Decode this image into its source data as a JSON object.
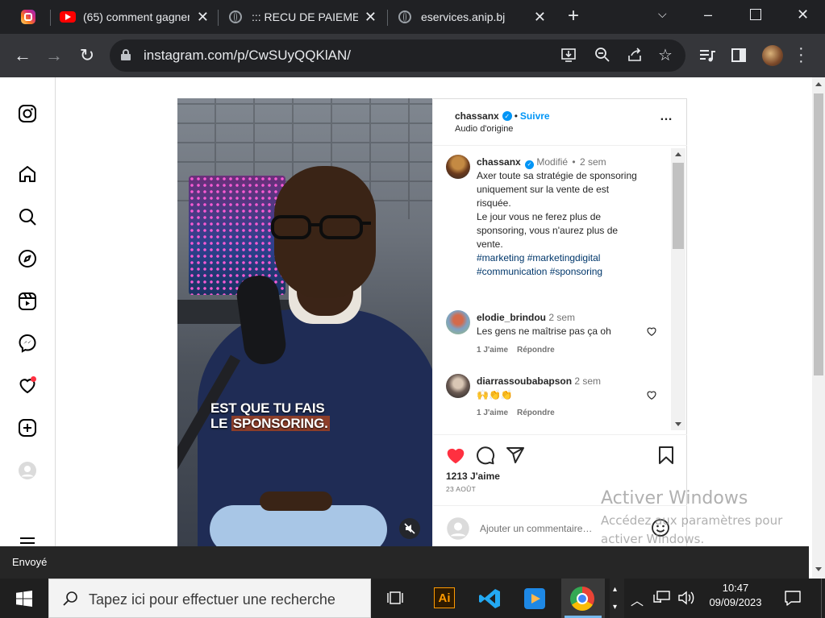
{
  "browser": {
    "tabs": [
      {
        "title": "(65) comment gagner",
        "icon": "youtube-icon"
      },
      {
        "title": "::: RECU DE PAIEMENT",
        "icon": "globe-icon"
      },
      {
        "title": "eservices.anip.bj",
        "icon": "globe-icon"
      }
    ],
    "new_tab": "+",
    "url": "instagram.com/p/CwSUyQQKlAN/"
  },
  "post": {
    "author": "chassanx",
    "follow_label": "Suivre",
    "audio_label": "Audio d'origine",
    "more_label": "…",
    "caption": {
      "author": "chassanx",
      "edited_label": "Modifié",
      "dot": "•",
      "time": "2 sem",
      "line1": "Axer toute sa stratégie de sponsoring",
      "line2": "uniquement sur la vente de est",
      "line3": "risquée.",
      "line4": "Le jour vous ne ferez plus de",
      "line5": "sponsoring, vous n'aurez plus de",
      "line6": "vente.",
      "tags1": "#marketing #marketingdigital",
      "tags2": "#communication #sponsoring"
    },
    "comments": [
      {
        "author": "elodie_brindou",
        "time": "2 sem",
        "text": "Les gens ne maîtrise pas ça oh",
        "likes": "1 J'aime",
        "reply": "Répondre"
      },
      {
        "author": "diarrassoubabapson",
        "time": "2 sem",
        "text": "🙌👏👏",
        "likes": "1 J'aime",
        "reply": "Répondre"
      }
    ],
    "likes": "1213 J'aime",
    "date": "23 AOÛT",
    "comment_placeholder": "Ajouter un commentaire…",
    "video_subtitle_1": "EST QUE TU FAIS",
    "video_subtitle_2a": "LE ",
    "video_subtitle_2b": "SPONSORING."
  },
  "snackbar": {
    "text": "Envoyé"
  },
  "watermark": {
    "line1": "Activer Windows",
    "line2": "Accédez aux paramètres pour",
    "line3": "activer Windows."
  },
  "taskbar": {
    "search_placeholder": "Tapez ici pour effectuer une recherche",
    "time": "10:47",
    "date": "09/09/2023"
  },
  "colors": {
    "accent": "#0095f6",
    "like": "#ff3040",
    "dark": "#202124"
  }
}
